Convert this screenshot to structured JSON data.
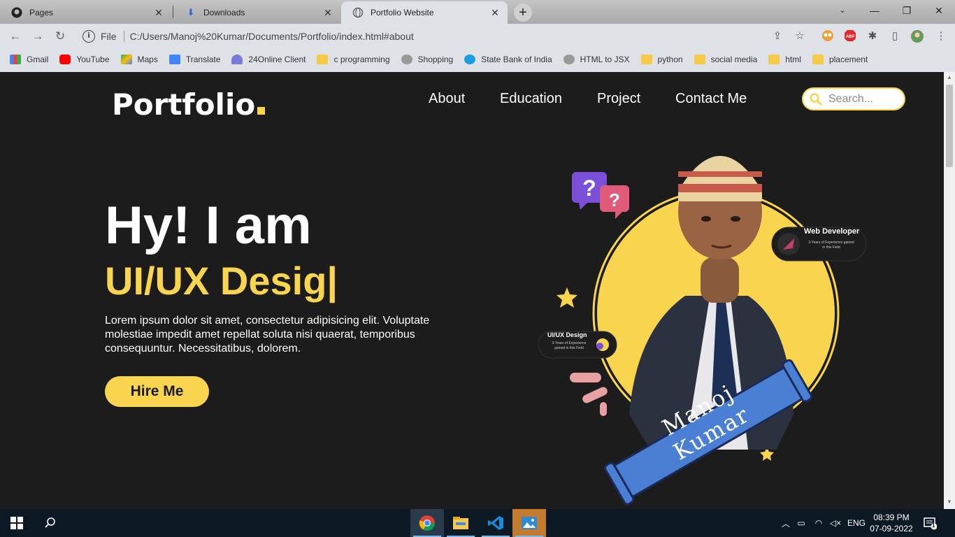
{
  "browser": {
    "tabs": [
      {
        "title": "Pages",
        "icon": "github-icon"
      },
      {
        "title": "Downloads",
        "icon": "download-icon"
      },
      {
        "title": "Portfolio Website",
        "icon": "globe-icon",
        "active": true
      }
    ],
    "address": {
      "scheme_label": "File",
      "url": "C:/Users/Manoj%20Kumar/Documents/Portfolio/index.html#about"
    },
    "bookmarks": [
      {
        "label": "Gmail",
        "icon": "gmail-icon"
      },
      {
        "label": "YouTube",
        "icon": "youtube-icon"
      },
      {
        "label": "Maps",
        "icon": "maps-icon"
      },
      {
        "label": "Translate",
        "icon": "translate-icon"
      },
      {
        "label": "24Online Client",
        "icon": "cloud-icon"
      },
      {
        "label": "c programming",
        "icon": "folder-icon"
      },
      {
        "label": "Shopping",
        "icon": "globe-icon"
      },
      {
        "label": "State Bank of India",
        "icon": "sbi-icon"
      },
      {
        "label": "HTML to JSX",
        "icon": "globe-icon"
      },
      {
        "label": "python",
        "icon": "folder-icon"
      },
      {
        "label": "social media",
        "icon": "folder-icon"
      },
      {
        "label": "html",
        "icon": "folder-icon"
      },
      {
        "label": "placement",
        "icon": "folder-icon"
      }
    ]
  },
  "site": {
    "logo": "Portfolio",
    "nav": [
      "About",
      "Education",
      "Project",
      "Contact Me"
    ],
    "search_placeholder": "Search...",
    "hero": {
      "intro": "Hy! I am",
      "role": "UI/UX Desig|",
      "description": "Lorem ipsum dolor sit amet, consectetur adipisicing elit. Voluptate molestiae impedit amet repellat soluta nisi quaerat, temporibus consequuntur. Necessitatibus, dolorem.",
      "cta": "Hire Me"
    },
    "badges": {
      "web_title": "Web Developer",
      "web_sub": "3-Years of Experience gained in this Field",
      "ui_title": "UI/UX Design",
      "ui_sub": "3-Years of Experience gained in this Field"
    },
    "banner_name": "Manoj Kumar",
    "colors": {
      "accent": "#f9d44f",
      "background": "#1c1c1c",
      "banner": "#4a7fd4"
    }
  },
  "taskbar": {
    "apps": [
      "chrome-icon",
      "file-explorer-icon",
      "vscode-icon",
      "photos-icon"
    ],
    "language": "ENG",
    "time": "08:39 PM",
    "date": "07-09-2022",
    "notifications": "1"
  }
}
